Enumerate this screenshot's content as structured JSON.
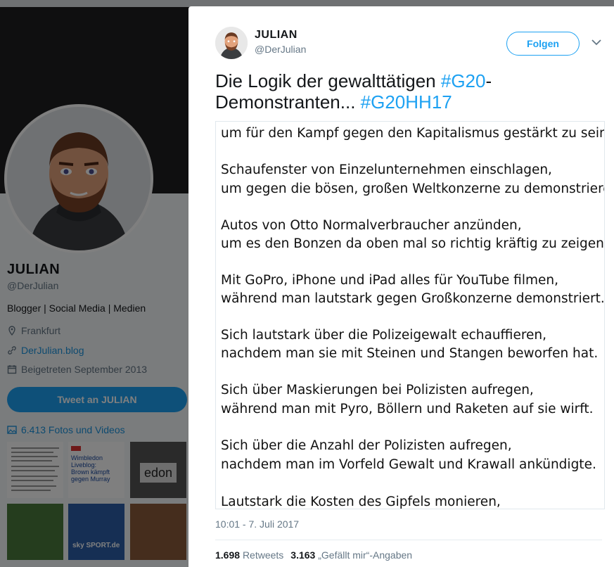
{
  "profile": {
    "name": "JULIAN",
    "handle": "@DerJulian",
    "bio": "Blogger | Social Media | Medien",
    "location": "Frankfurt",
    "website": "DerJulian.blog",
    "joined": "Beigetreten September 2013",
    "tweet_to": "Tweet an JULIAN",
    "photos_videos": "6.413 Fotos und Videos",
    "thumb_news_title": "Wimbledon Liveblog: Brown kämpft gegen Murray",
    "thumb_sport_text": "sky SPORT.de",
    "thumb_edon_text": "edon"
  },
  "tweet": {
    "author_name": "JULIAN",
    "author_handle": "@DerJulian",
    "follow_label": "Folgen",
    "text_plain_1": "Die Logik der gewalttätigen ",
    "hashtag_1": "#G20",
    "text_plain_2": "-",
    "text_plain_3": "Demonstranten... ",
    "hashtag_2": "#G20HH17",
    "image_lines": [
      "um für den Kampf gegen den Kapitalismus gestärkt zu sein.",
      "Schaufenster von Einzelunternehmen einschlagen,",
      "um gegen die bösen, großen Weltkonzerne zu demonstrieren.",
      "Autos von Otto Normalverbraucher anzünden,",
      "um es den Bonzen da oben mal so richtig kräftig zu zeigen.",
      "Mit GoPro, iPhone und iPad alles für YouTube filmen,",
      "während man lautstark gegen Großkonzerne demonstriert.",
      "Sich lautstark über die Polizeigewalt echauffieren,",
      "nachdem man sie mit Steinen und Stangen beworfen hat.",
      "Sich über Maskierungen bei Polizisten aufregen,",
      "während man mit Pyro, Böllern und Raketen auf sie wirft.",
      "Sich über die Anzahl der Polizisten aufregen,",
      "nachdem man im Vorfeld Gewalt und Krawall ankündigte.",
      "Lautstark die Kosten des Gipfels monieren,"
    ],
    "timestamp": "10:01 - 7. Juli 2017",
    "retweets_count": "1.698",
    "retweets_label": "Retweets",
    "likes_count": "3.163",
    "likes_label": "„Gefällt mir“-Angaben"
  },
  "colors": {
    "accent": "#1da1f2",
    "text": "#14171a",
    "muted": "#657786"
  }
}
